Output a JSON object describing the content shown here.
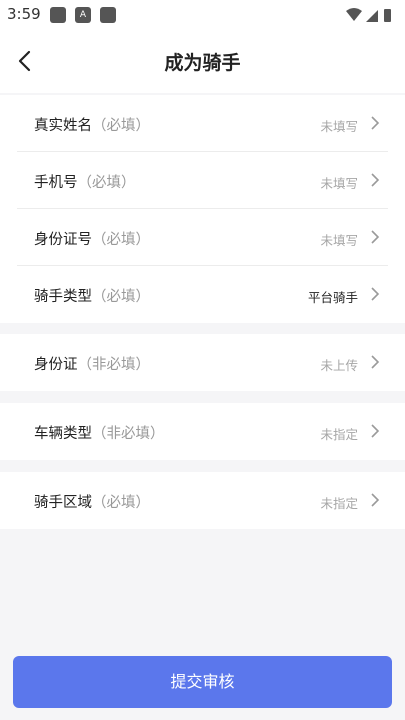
{
  "status_bar": {
    "time": "3:59",
    "notif_letter": "A"
  },
  "header": {
    "title": "成为骑手"
  },
  "sections": [
    {
      "rows": [
        {
          "label": "真实姓名",
          "hint": "（必填）",
          "value": "未填写",
          "value_set": false
        },
        {
          "label": "手机号",
          "hint": "（必填）",
          "value": "未填写",
          "value_set": false
        },
        {
          "label": "身份证号",
          "hint": "（必填）",
          "value": "未填写",
          "value_set": false
        },
        {
          "label": "骑手类型",
          "hint": "（必填）",
          "value": "平台骑手",
          "value_set": true
        }
      ]
    },
    {
      "rows": [
        {
          "label": "身份证",
          "hint": "（非必填）",
          "value": "未上传",
          "value_set": false
        }
      ]
    },
    {
      "rows": [
        {
          "label": "车辆类型",
          "hint": "（非必填）",
          "value": "未指定",
          "value_set": false
        }
      ]
    },
    {
      "rows": [
        {
          "label": "骑手区域",
          "hint": "（必填）",
          "value": "未指定",
          "value_set": false
        }
      ]
    }
  ],
  "submit": {
    "label": "提交审核"
  },
  "colors": {
    "accent": "#5b77ec",
    "placeholder": "#a6a6a6",
    "background": "#f5f5f7"
  }
}
